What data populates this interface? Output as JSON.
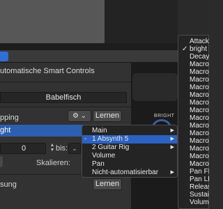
{
  "panel": {
    "title": "utomatische Smart Controls",
    "patch_name": "Babelfisch",
    "mapping_label": "pping",
    "gear_label": "⚙︎ ⌄",
    "learn_label_1": "Lernen",
    "selected_row": "ght",
    "range_value": "0",
    "range_to_label": "bis:",
    "scale_label": "Skalieren:",
    "bottom_label": "sung",
    "learn_label_2": "Lernen",
    "knob_label": "BRIGHT"
  },
  "menu_main": {
    "items": [
      {
        "label": "Main",
        "arrow": "▶",
        "highlighted": false
      },
      {
        "label": "1 Absynth 5",
        "prefix": "-",
        "arrow": "▶",
        "highlighted": true
      },
      {
        "label": "2 Guitar Rig",
        "arrow": "▶",
        "highlighted": false
      },
      {
        "label": "Volume",
        "highlighted": false
      },
      {
        "label": "Pan",
        "highlighted": false
      },
      {
        "label": "Nicht-automatisierbar",
        "arrow": "▶",
        "highlighted": false
      }
    ]
  },
  "menu_params": {
    "items": [
      {
        "label": "Attack",
        "checked": false
      },
      {
        "label": "bright",
        "checked": true
      },
      {
        "label": "Decay",
        "checked": false
      },
      {
        "label": "Macro",
        "checked": false
      },
      {
        "label": "Macro",
        "checked": false
      },
      {
        "label": "Macro",
        "checked": false
      },
      {
        "label": "Macro",
        "checked": false
      },
      {
        "label": "Macro",
        "checked": false
      },
      {
        "label": "Macro",
        "checked": false
      },
      {
        "label": "Macro",
        "checked": false
      },
      {
        "label": "Macro",
        "checked": false
      },
      {
        "label": "Macro",
        "checked": false
      },
      {
        "label": "Macro",
        "checked": false
      },
      {
        "label": "Macro",
        "checked": false
      },
      {
        "label": "Macro",
        "checked": false
      },
      {
        "label": "Macro",
        "checked": false
      },
      {
        "label": "Macro",
        "checked": false
      },
      {
        "label": "Pan FB",
        "checked": false
      },
      {
        "label": "Pan LR",
        "checked": false
      },
      {
        "label": "Releas",
        "checked": false
      },
      {
        "label": "Sustair",
        "checked": false
      },
      {
        "label": "Volume",
        "checked": false
      }
    ]
  },
  "colors": {
    "accent": "#2c63c2",
    "panel_bg": "#323232",
    "menu_bg": "#242424"
  }
}
